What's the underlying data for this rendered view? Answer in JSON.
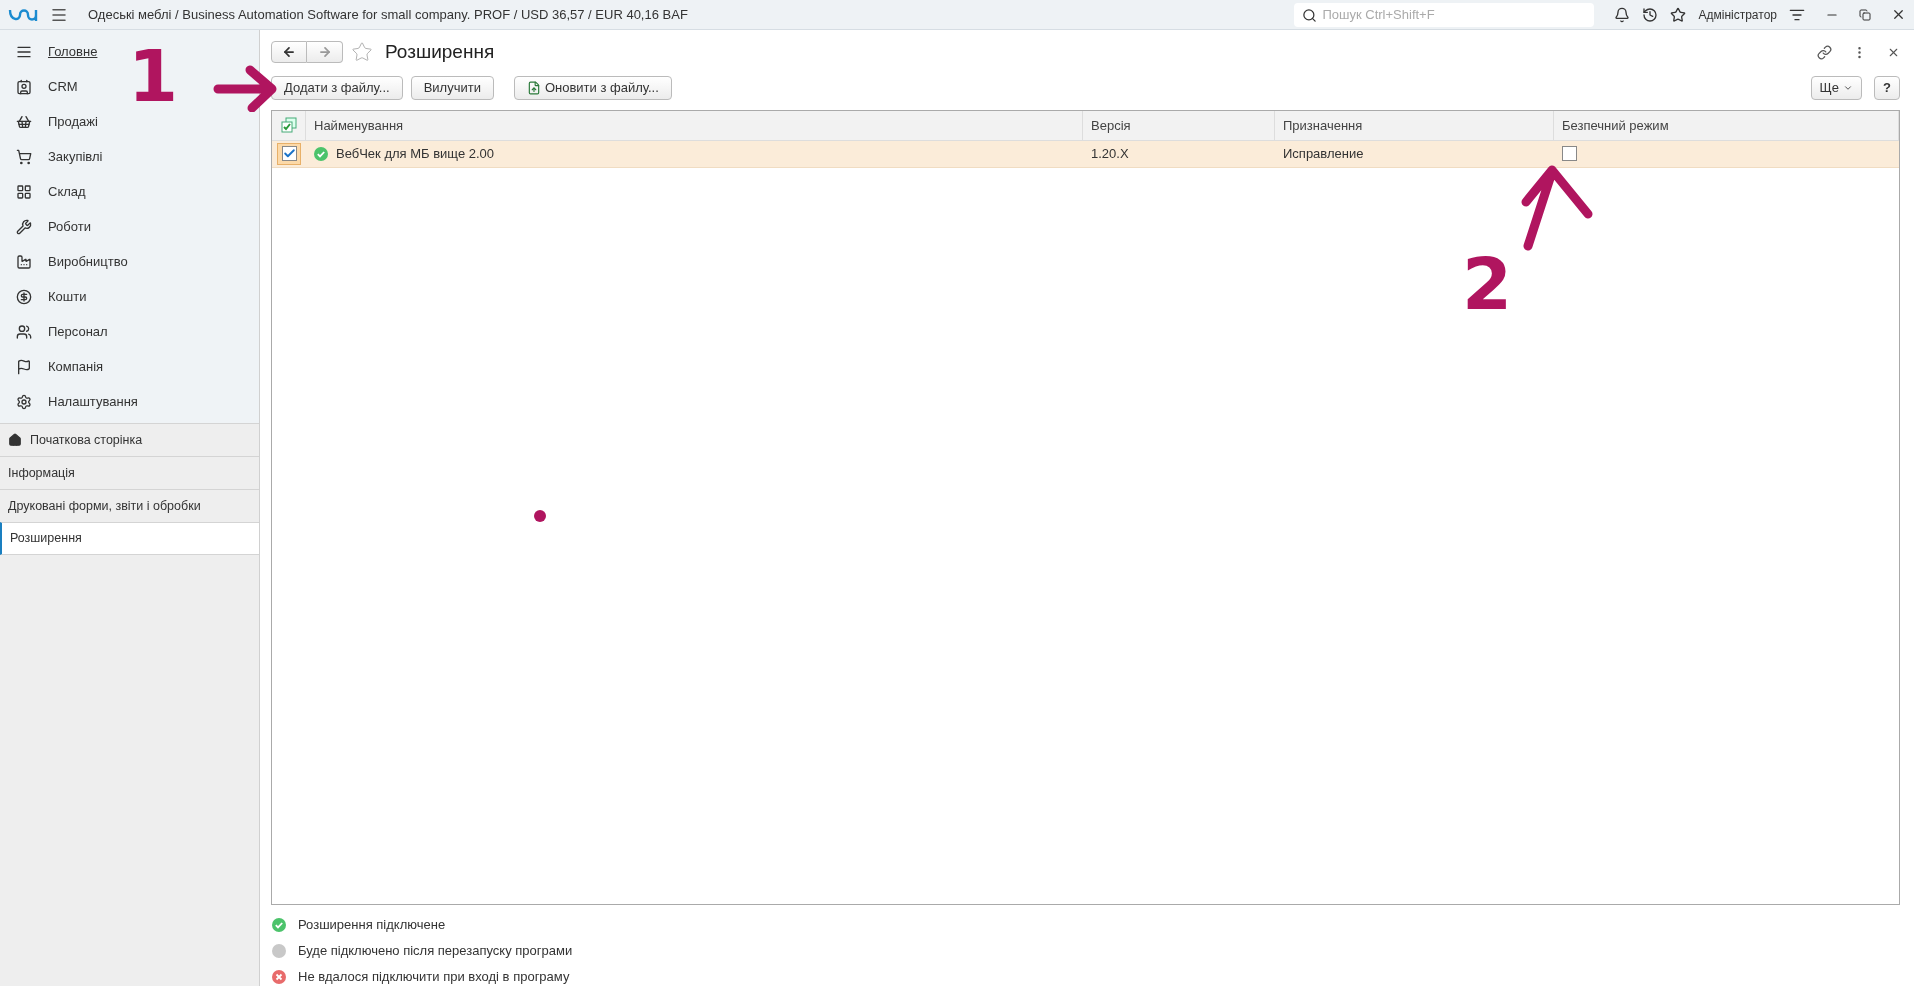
{
  "app_bar": {
    "title": "Одеські меблі / Business Automation Software for small company. PROF / USD 36,57 / EUR 40,16 BAF",
    "search": {
      "placeholder": "Пошук Ctrl+Shift+F"
    },
    "user": "Адміністратор"
  },
  "sidebar": {
    "items": [
      {
        "label": "Головне",
        "selected": true
      },
      {
        "label": "CRM",
        "selected": false
      },
      {
        "label": "Продажі",
        "selected": false
      },
      {
        "label": "Закупівлі",
        "selected": false
      },
      {
        "label": "Склад",
        "selected": false
      },
      {
        "label": "Роботи",
        "selected": false
      },
      {
        "label": "Виробництво",
        "selected": false
      },
      {
        "label": "Кошти",
        "selected": false
      },
      {
        "label": "Персонал",
        "selected": false
      },
      {
        "label": "Компанія",
        "selected": false
      },
      {
        "label": "Налаштування",
        "selected": false
      }
    ],
    "links": [
      {
        "label": "Початкова сторінка",
        "selected": false,
        "kind": "home"
      },
      {
        "label": "Інформація",
        "selected": false,
        "kind": "plain"
      },
      {
        "label": "Друковані форми, звіти і обробки",
        "selected": false,
        "kind": "plain"
      },
      {
        "label": "Розширення",
        "selected": true,
        "kind": "plain"
      }
    ]
  },
  "form": {
    "title": "Розширення",
    "favorite": false,
    "buttons": [
      {
        "label": "Додати з файлу...",
        "kind": "plain"
      },
      {
        "label": "Вилучити",
        "kind": "plain"
      },
      {
        "label": "Оновити з файлу...",
        "kind": "icon"
      }
    ],
    "more_button": "Ще",
    "help_button": "?",
    "table": {
      "columns": [
        "Найменування",
        "Версія",
        "Призначення",
        "Безпечний режим"
      ],
      "rows": [
        {
          "selected": true,
          "active": true,
          "kind": "connected",
          "name": "ВебЧек для МБ вище 2.00",
          "version": "1.20.X",
          "purpose": "Исправление",
          "safe_mode": false
        }
      ]
    },
    "legend": [
      {
        "kind": "connected",
        "text": "Розширення підключене"
      },
      {
        "kind": "pending",
        "text": "Буде підключено після перезапуску програми"
      },
      {
        "kind": "failed",
        "text": "Не вдалося підключити при вході в програму"
      }
    ]
  },
  "annotations": [
    {
      "kind": "number",
      "text": "1"
    },
    {
      "kind": "arrow-right"
    },
    {
      "kind": "number",
      "text": "2"
    },
    {
      "kind": "arrow-up"
    },
    {
      "kind": "dot"
    }
  ]
}
